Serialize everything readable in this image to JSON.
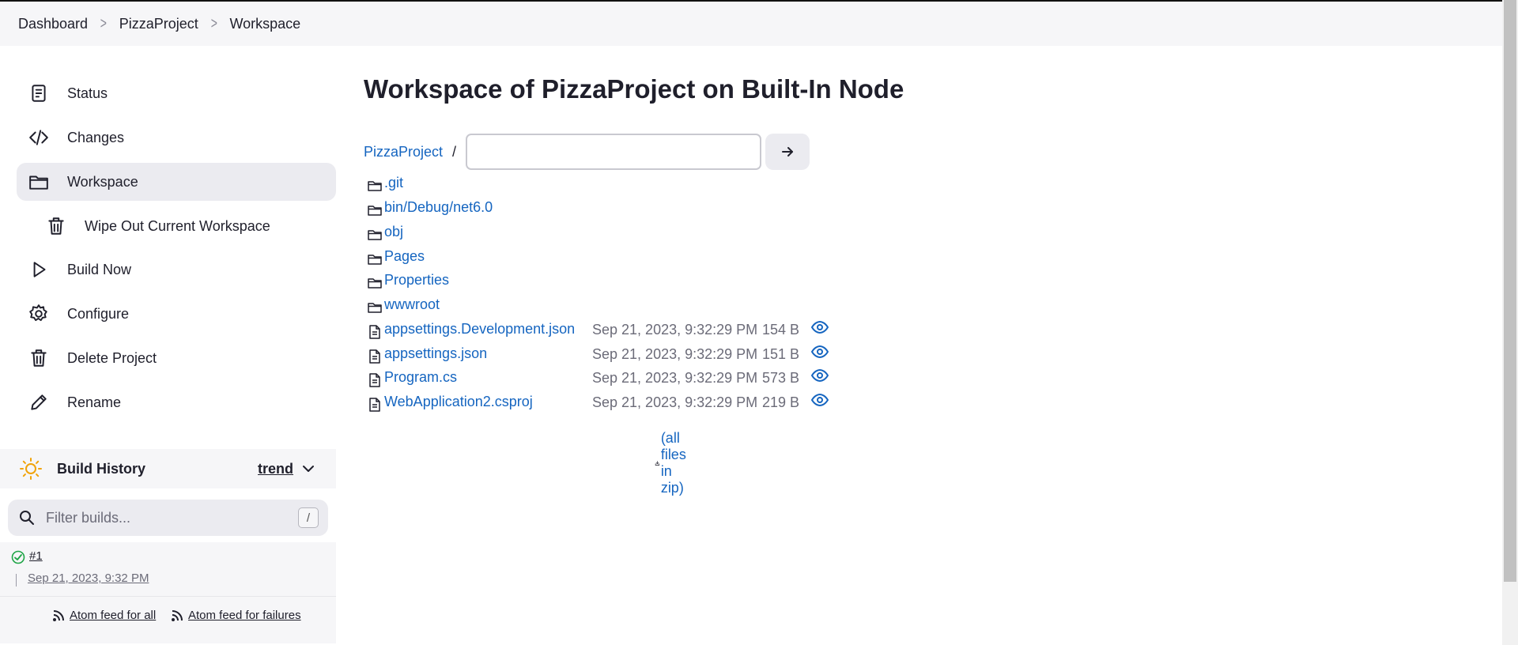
{
  "breadcrumb": [
    "Dashboard",
    "PizzaProject",
    "Workspace"
  ],
  "sidebar": {
    "items": [
      {
        "label": "Status",
        "icon": "status-icon"
      },
      {
        "label": "Changes",
        "icon": "code-icon"
      },
      {
        "label": "Workspace",
        "icon": "folder-icon",
        "active": true
      },
      {
        "label": "Wipe Out Current Workspace",
        "icon": "trash-icon",
        "sub": true
      },
      {
        "label": "Build Now",
        "icon": "play-icon"
      },
      {
        "label": "Configure",
        "icon": "gear-icon"
      },
      {
        "label": "Delete Project",
        "icon": "trash-icon"
      },
      {
        "label": "Rename",
        "icon": "pencil-icon"
      }
    ]
  },
  "build_history": {
    "title": "Build History",
    "trend_label": "trend",
    "filter_placeholder": "Filter builds...",
    "filter_shortcut": "/",
    "builds": [
      {
        "number": "#1",
        "date": "Sep 21, 2023, 9:32 PM",
        "status": "success"
      }
    ],
    "feed_all": "Atom feed for all",
    "feed_failures": "Atom feed for failures"
  },
  "main": {
    "title": "Workspace of PizzaProject on Built-In Node",
    "path_root": "PizzaProject",
    "path_sep": "/",
    "path_input_value": "",
    "folders": [
      ".git",
      "bin/Debug/net6.0",
      "obj",
      "Pages",
      "Properties",
      "wwwroot"
    ],
    "files": [
      {
        "name": "appsettings.Development.json",
        "date": "Sep 21, 2023, 9:32:29 PM",
        "size": "154 B"
      },
      {
        "name": "appsettings.json",
        "date": "Sep 21, 2023, 9:32:29 PM",
        "size": "151 B"
      },
      {
        "name": "Program.cs",
        "date": "Sep 21, 2023, 9:32:29 PM",
        "size": "573 B"
      },
      {
        "name": "WebApplication2.csproj",
        "date": "Sep 21, 2023, 9:32:29 PM",
        "size": "219 B"
      }
    ],
    "zip_label": "(all files in zip)"
  },
  "colors": {
    "link": "#1565c0",
    "success": "#1ea446",
    "sun": "#f0a30a"
  }
}
